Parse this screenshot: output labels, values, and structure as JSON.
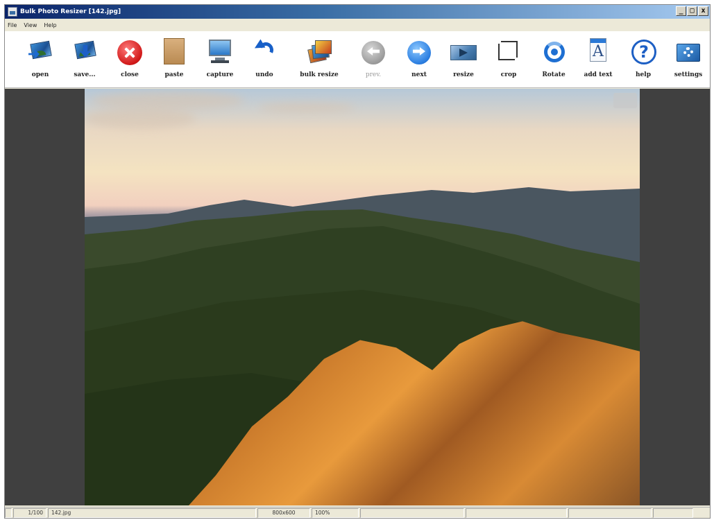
{
  "window": {
    "title": "Bulk Photo Resizer [142.jpg]",
    "controls": [
      "_",
      "□",
      "x"
    ]
  },
  "menu": [
    "File",
    "View",
    "Help"
  ],
  "toolbar": [
    {
      "label": "open",
      "icon": "open-icon",
      "enabled": true
    },
    {
      "label": "save...",
      "icon": "save-icon",
      "enabled": true
    },
    {
      "label": "close",
      "icon": "close-icon",
      "enabled": true
    },
    {
      "label": "paste",
      "icon": "paste-icon",
      "enabled": true
    },
    {
      "label": "capture",
      "icon": "capture-icon",
      "enabled": true
    },
    {
      "label": "undo",
      "icon": "undo-icon",
      "enabled": true
    },
    {
      "label": "bulk resize",
      "icon": "bulk-resize-icon",
      "enabled": true
    },
    {
      "label": "prev.",
      "icon": "prev-icon",
      "enabled": false
    },
    {
      "label": "next",
      "icon": "next-icon",
      "enabled": true
    },
    {
      "label": "resize",
      "icon": "resize-icon",
      "enabled": true
    },
    {
      "label": "crop",
      "icon": "crop-icon",
      "enabled": true
    },
    {
      "label": "Rotate",
      "icon": "rotate-icon",
      "enabled": true
    },
    {
      "label": "add text",
      "icon": "add-text-icon",
      "enabled": true
    },
    {
      "label": "help",
      "icon": "help-icon",
      "enabled": true
    },
    {
      "label": "settings",
      "icon": "settings-icon",
      "enabled": true
    }
  ],
  "status": {
    "counter": "1/100",
    "filename": "142.jpg",
    "dimensions": "800x600",
    "zoom": "100%"
  },
  "colors": {
    "titlebar_start": "#0a246a",
    "titlebar_end": "#a6caf0",
    "canvas_background": "#404040"
  }
}
